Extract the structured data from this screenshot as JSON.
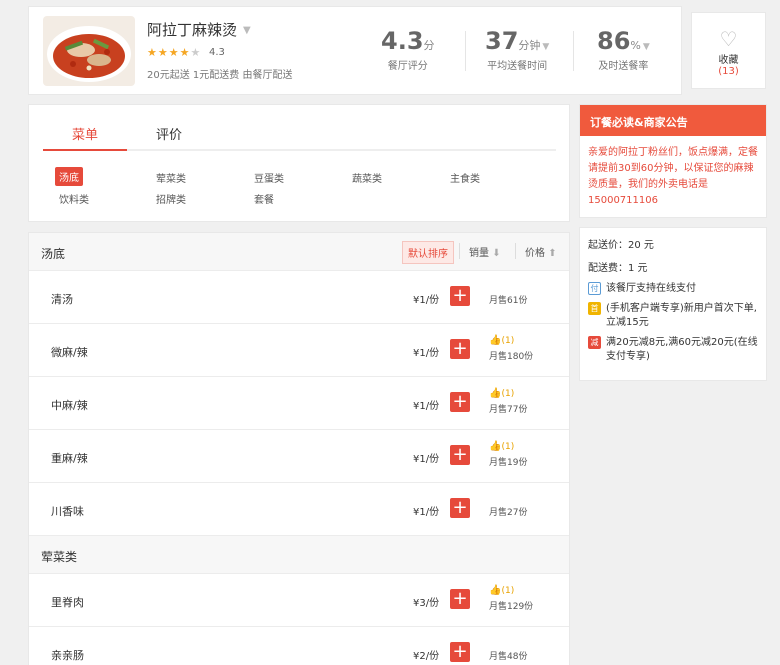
{
  "shop": {
    "name": "阿拉丁麻辣烫",
    "rating_text": "4.3",
    "stars": 4,
    "delivery_info": "20元起送 1元配送费 由餐厅配送"
  },
  "stats": [
    {
      "value": "4.3",
      "unit": "分",
      "label": "餐厅评分"
    },
    {
      "value": "37",
      "unit": "分钟",
      "label": "平均送餐时间"
    },
    {
      "value": "86",
      "unit": "%",
      "label": "及时送餐率"
    }
  ],
  "favorite": {
    "label": "收藏",
    "count": "(13)"
  },
  "tabs": [
    "菜单",
    "评价"
  ],
  "categories": [
    "汤底",
    "荤菜类",
    "豆蛋类",
    "蔬菜类",
    "主食类",
    "饮料类",
    "招牌类",
    "套餐"
  ],
  "sort": {
    "default": "默认排序",
    "sales": "销量",
    "price": "价格"
  },
  "sections": [
    {
      "title": "汤底",
      "dishes": [
        {
          "name": "清汤",
          "price": "¥1/份",
          "likes": "",
          "sold": "月售61份"
        },
        {
          "name": "微麻/辣",
          "price": "¥1/份",
          "likes": "(1)",
          "sold": "月售180份"
        },
        {
          "name": "中麻/辣",
          "price": "¥1/份",
          "likes": "(1)",
          "sold": "月售77份"
        },
        {
          "name": "重麻/辣",
          "price": "¥1/份",
          "likes": "(1)",
          "sold": "月售19份"
        },
        {
          "name": "川香味",
          "price": "¥1/份",
          "likes": "",
          "sold": "月售27份"
        }
      ]
    },
    {
      "title": "荤菜类",
      "dishes": [
        {
          "name": "里脊肉",
          "price": "¥3/份",
          "likes": "(1)",
          "sold": "月售129份"
        },
        {
          "name": "亲亲肠",
          "price": "¥2/份",
          "likes": "",
          "sold": "月售48份"
        }
      ]
    }
  ],
  "notice": {
    "title": "订餐必读&商家公告",
    "body": "亲爱的阿拉丁粉丝们，饭点爆满，定餐请提前30到60分钟，以保证您的麻辣烫质量，我们的外卖电话是15000711106"
  },
  "info": {
    "min_order": "起送价：20 元",
    "delivery_fee": "配送费：1 元",
    "promos": [
      {
        "badge": "付",
        "text": "该餐厅支持在线支付"
      },
      {
        "badge": "首",
        "text": "(手机客户端专享)新用户首次下单,立减15元"
      },
      {
        "badge": "减",
        "text": "满20元减8元,满60元减20元(在线支付专享)"
      }
    ]
  },
  "colors": {
    "accent": "#e64a3b",
    "notice_header": "#f05a3d",
    "star": "#f5a623"
  }
}
